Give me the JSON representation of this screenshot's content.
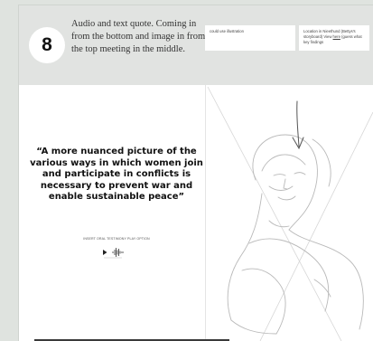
{
  "step": {
    "number": "8",
    "description": "Audio and text quote. Coming in from the bottom and image in from the top meeting in the middle."
  },
  "notes": [
    {
      "text": "could use illustration"
    },
    {
      "text_pre": "Location in Nieethund (Bettys's storyboard) View ",
      "link": "here",
      "text_post": " (guess what key findings"
    }
  ],
  "quote": {
    "text": "“A more nuanced picture of the various ways in which women join and participate in conflicts is necessary to prevent war and enable sustainable peace”"
  },
  "audio": {
    "placeholder_label": "INSERT ORAL TESTIMONY PLAY OPTION",
    "icons": [
      "play-icon",
      "waveform-icon"
    ]
  },
  "illustration": {
    "icon": "woman-line-drawing",
    "arrow": "down-arrow-icon"
  }
}
